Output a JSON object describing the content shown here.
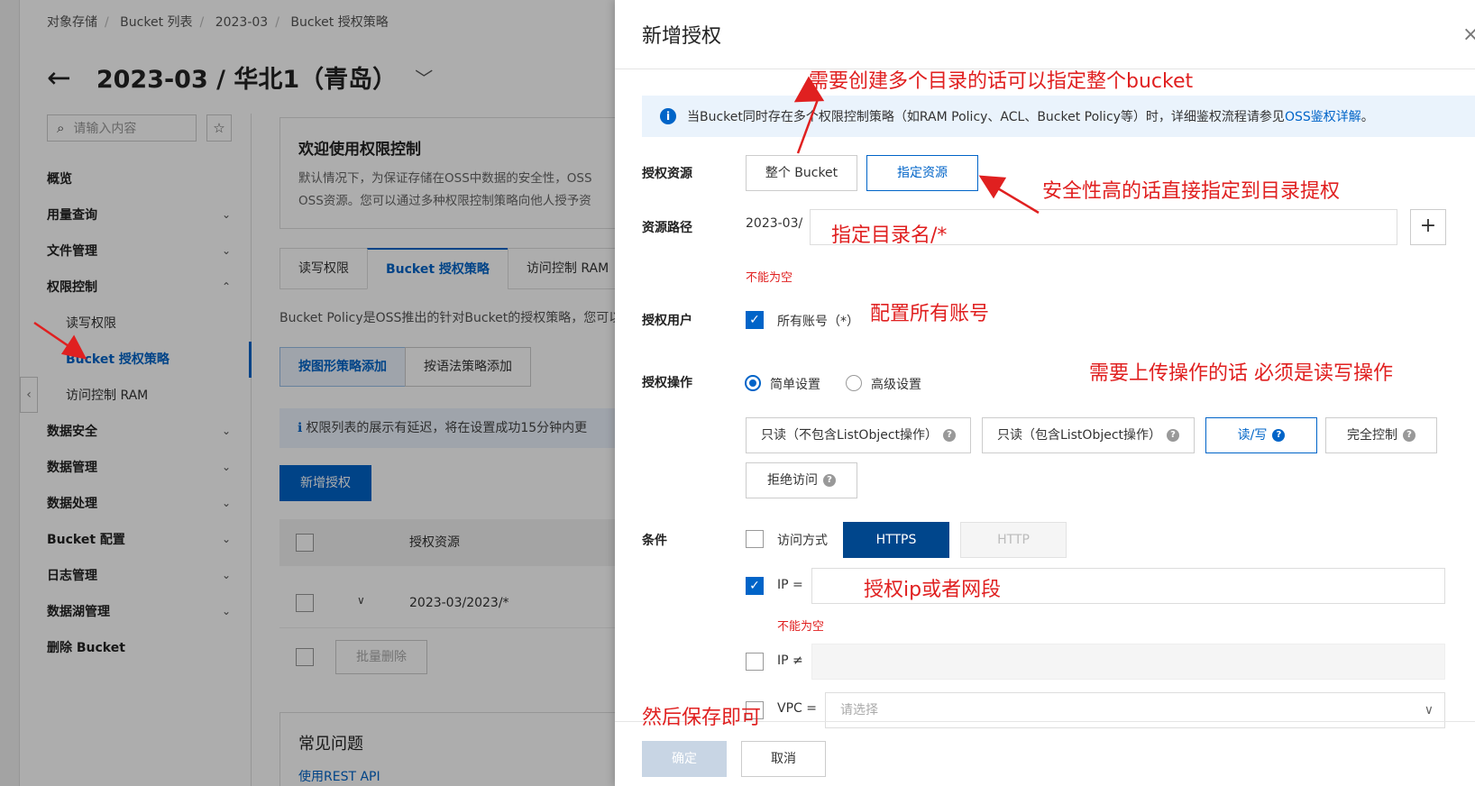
{
  "breadcrumb": [
    "对象存储",
    "Bucket 列表",
    "2023-03",
    "Bucket 授权策略"
  ],
  "page_title": "2023-03 / 华北1（青岛）",
  "side_search_placeholder": "请输入内容",
  "side_nav": [
    {
      "label": "概览",
      "type": "top",
      "chev": ""
    },
    {
      "label": "用量查询",
      "type": "top",
      "chev": "⌄"
    },
    {
      "label": "文件管理",
      "type": "top",
      "chev": "⌄"
    },
    {
      "label": "权限控制",
      "type": "top",
      "chev": "⌃"
    },
    {
      "label": "读写权限",
      "type": "sub",
      "chev": ""
    },
    {
      "label": "Bucket 授权策略",
      "type": "sub-active",
      "chev": ""
    },
    {
      "label": "访问控制 RAM",
      "type": "sub",
      "chev": ""
    },
    {
      "label": "数据安全",
      "type": "top",
      "chev": "⌄"
    },
    {
      "label": "数据管理",
      "type": "top",
      "chev": "⌄"
    },
    {
      "label": "数据处理",
      "type": "top",
      "chev": "⌄"
    },
    {
      "label": "Bucket 配置",
      "type": "top",
      "chev": "⌄"
    },
    {
      "label": "日志管理",
      "type": "top",
      "chev": "⌄"
    },
    {
      "label": "数据湖管理",
      "type": "top",
      "chev": "⌄"
    },
    {
      "label": "删除 Bucket",
      "type": "top",
      "chev": ""
    }
  ],
  "welcome": {
    "title": "欢迎使用权限控制",
    "line1": "默认情况下，为保证存储在OSS中数据的安全性，OSS",
    "line2": "OSS资源。您可以通过多种权限控制策略向他人授予资"
  },
  "tabs": [
    "读写权限",
    "Bucket 授权策略",
    "访问控制 RAM"
  ],
  "policy_desc": "Bucket Policy是OSS推出的针对Bucket的授权策略，您可以",
  "mode_buttons": [
    "按图形策略添加",
    "按语法策略添加"
  ],
  "notice": "权限列表的展示有延迟，将在设置成功15分钟内更",
  "add_auth_btn": "新增授权",
  "table": {
    "header": "授权资源",
    "row": "2023-03/2023/*",
    "bulk_delete": "批量删除"
  },
  "faq": {
    "title": "常见问题",
    "link": "使用REST API"
  },
  "drawer": {
    "title": "新增授权",
    "close": "×",
    "info_text": "当Bucket同时存在多个权限控制策略（如RAM Policy、ACL、Bucket Policy等）时，详细鉴权流程请参见",
    "info_link": "OSS鉴权详解",
    "info_tail": "。",
    "labels": {
      "resource": "授权资源",
      "path": "资源路径",
      "user": "授权用户",
      "operation": "授权操作",
      "condition": "条件"
    },
    "resource_options": [
      "整个 Bucket",
      "指定资源"
    ],
    "path_prefix": "2023-03/",
    "path_value": "",
    "plus": "+",
    "required_error": "不能为空",
    "all_accounts": "所有账号（*）",
    "op_modes": [
      "简单设置",
      "高级设置"
    ],
    "op_buttons": [
      "只读（不包含ListObject操作）",
      "只读（包含ListObject操作）",
      "读/写",
      "完全控制",
      "拒绝访问"
    ],
    "cond_access": "访问方式",
    "protocols": [
      "HTTPS",
      "HTTP"
    ],
    "ip_eq": "IP =",
    "ip_neq": "IP ≠",
    "vpc": "VPC =",
    "vpc_placeholder": "请选择",
    "ok": "确定",
    "cancel": "取消"
  },
  "annotations": {
    "a1": "需要创建多个目录的话可以指定整个bucket",
    "a2": "安全性高的话直接指定到目录提权",
    "a3": "指定目录名/*",
    "a4": "配置所有账号",
    "a5": "需要上传操作的话 必须是读写操作",
    "a6": "授权ip或者网段",
    "a7": "然后保存即可"
  },
  "colors": {
    "accent": "#0064c8",
    "annotation": "#e02020"
  },
  "icons": {
    "back": "arrow-left-icon",
    "search": "search-icon",
    "star": "star-icon",
    "info": "info-icon",
    "help": "help-icon",
    "close": "close-icon"
  }
}
